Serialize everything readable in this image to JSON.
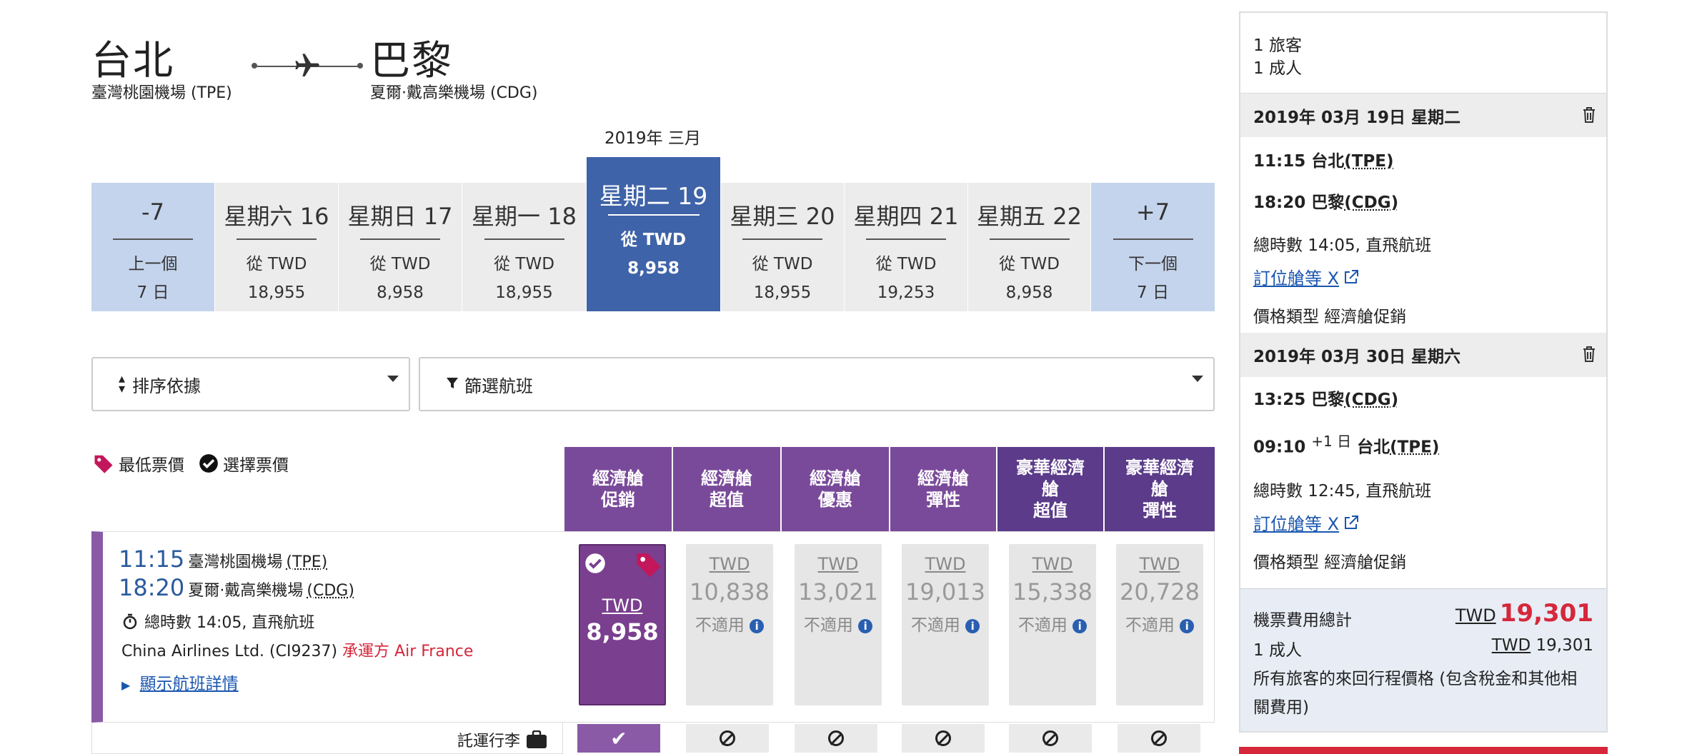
{
  "header": {
    "origin_city": "台北",
    "origin_airport": "臺灣桃園機場 (TPE)",
    "dest_city": "巴黎",
    "dest_airport": "夏爾·戴高樂機場 (CDG)",
    "month_label": "2019年 三月"
  },
  "date_strip": {
    "prev": {
      "label": "-7",
      "sub1": "上一個",
      "sub2": "7 日"
    },
    "next": {
      "label": "+7",
      "sub1": "下一個",
      "sub2": "7 日"
    },
    "days": [
      {
        "label": "星期六 16",
        "from": "從 TWD",
        "price": "18,955"
      },
      {
        "label": "星期日 17",
        "from": "從 TWD",
        "price": "8,958"
      },
      {
        "label": "星期一 18",
        "from": "從 TWD",
        "price": "18,955"
      },
      {
        "label": "星期二 19",
        "from": "從 TWD",
        "price": "8,958"
      },
      {
        "label": "星期三 20",
        "from": "從 TWD",
        "price": "18,955"
      },
      {
        "label": "星期四 21",
        "from": "從 TWD",
        "price": "19,253"
      },
      {
        "label": "星期五 22",
        "from": "從 TWD",
        "price": "8,958"
      }
    ]
  },
  "controls": {
    "sort_label": "排序依據",
    "filter_label": "篩選航班"
  },
  "legend": {
    "lowest": "最低票價",
    "selected": "選擇票價"
  },
  "fare_headers": [
    {
      "l1": "經濟艙",
      "l2": "促銷",
      "l3": ""
    },
    {
      "l1": "經濟艙",
      "l2": "超值",
      "l3": ""
    },
    {
      "l1": "經濟艙",
      "l2": "優惠",
      "l3": ""
    },
    {
      "l1": "經濟艙",
      "l2": "彈性",
      "l3": ""
    },
    {
      "l1": "豪華經濟",
      "l2": "艙",
      "l3": "超值"
    },
    {
      "l1": "豪華經濟",
      "l2": "艙",
      "l3": "彈性"
    }
  ],
  "flight": {
    "dep_time": "11:15",
    "dep_airport": "臺灣桃園機場",
    "dep_code": "(TPE)",
    "arr_time": "18:20",
    "arr_airport": "夏爾·戴高樂機場",
    "arr_code": "(CDG)",
    "duration": "總時數 14:05, 直飛航班",
    "carrier": "China Airlines Ltd. (CI9237)",
    "operated_by": "承運方 Air France",
    "details_link": "顯示航班詳情",
    "baggage_label": "託運行李",
    "fares": [
      {
        "cur": "TWD",
        "amount": "8,958",
        "na": "",
        "selected": true
      },
      {
        "cur": "TWD",
        "amount": "10,838",
        "na": "不適用"
      },
      {
        "cur": "TWD",
        "amount": "13,021",
        "na": "不適用"
      },
      {
        "cur": "TWD",
        "amount": "19,013",
        "na": "不適用"
      },
      {
        "cur": "TWD",
        "amount": "15,338",
        "na": "不適用"
      },
      {
        "cur": "TWD",
        "amount": "20,728",
        "na": "不適用"
      }
    ],
    "check_mark": "✔"
  },
  "summary": {
    "travellers": "1 旅客",
    "adults": "1 成人",
    "outbound": {
      "date": "2019年 03月 19日 星期二",
      "dep_time": "11:15 台北",
      "dep_code": "(TPE)",
      "arr_time": "18:20 巴黎",
      "arr_code": "(CDG)",
      "duration": "總時數 14:05, 直飛航班",
      "booking_class": "訂位艙等 X",
      "fare_type": "價格類型 經濟艙促銷"
    },
    "inbound": {
      "date": "2019年 03月 30日 星期六",
      "dep_time": "13:25 巴黎",
      "dep_code": "(CDG)",
      "arr_time": "09:10",
      "arr_plus": "+1 日",
      "arr_city": "台北",
      "arr_code": "(TPE)",
      "duration": "總時數 12:45, 直飛航班",
      "booking_class": "訂位艙等 X",
      "fare_type": "價格類型 經濟艙促銷"
    },
    "total_label": "機票費用總計",
    "total_cur": "TWD",
    "total_amount": "19,301",
    "adult_line": "1 成人",
    "adult_cur": "TWD",
    "adult_amount": "19,301",
    "note": "所有旅客的來回行程價格 (包含稅金和其他相關費用)"
  },
  "colors": {
    "selected_date": "#3f63a8",
    "nav_date": "#c5d4ed",
    "fare_purple": "#7a4a9a",
    "price_red": "#d6273b",
    "link_blue": "#1a56b0"
  }
}
